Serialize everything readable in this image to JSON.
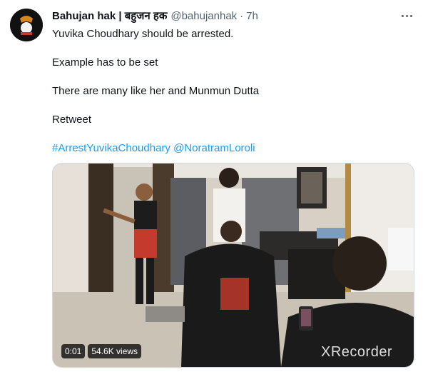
{
  "tweet": {
    "author_name": "Bahujan hak | बहुजन हक",
    "author_handle": "@bahujanhak",
    "separator": "·",
    "time": "7h",
    "lines": [
      "Yuvika Choudhary should be arrested.",
      "Example has to be set",
      "There are many like her and Munmun Dutta",
      "Retweet"
    ],
    "hashtag": "#ArrestYuvikaChoudhary",
    "mention": "@NoratramLoroli"
  },
  "video": {
    "duration": "0:01",
    "views": "54.6K views",
    "watermark": "XRecorder"
  }
}
